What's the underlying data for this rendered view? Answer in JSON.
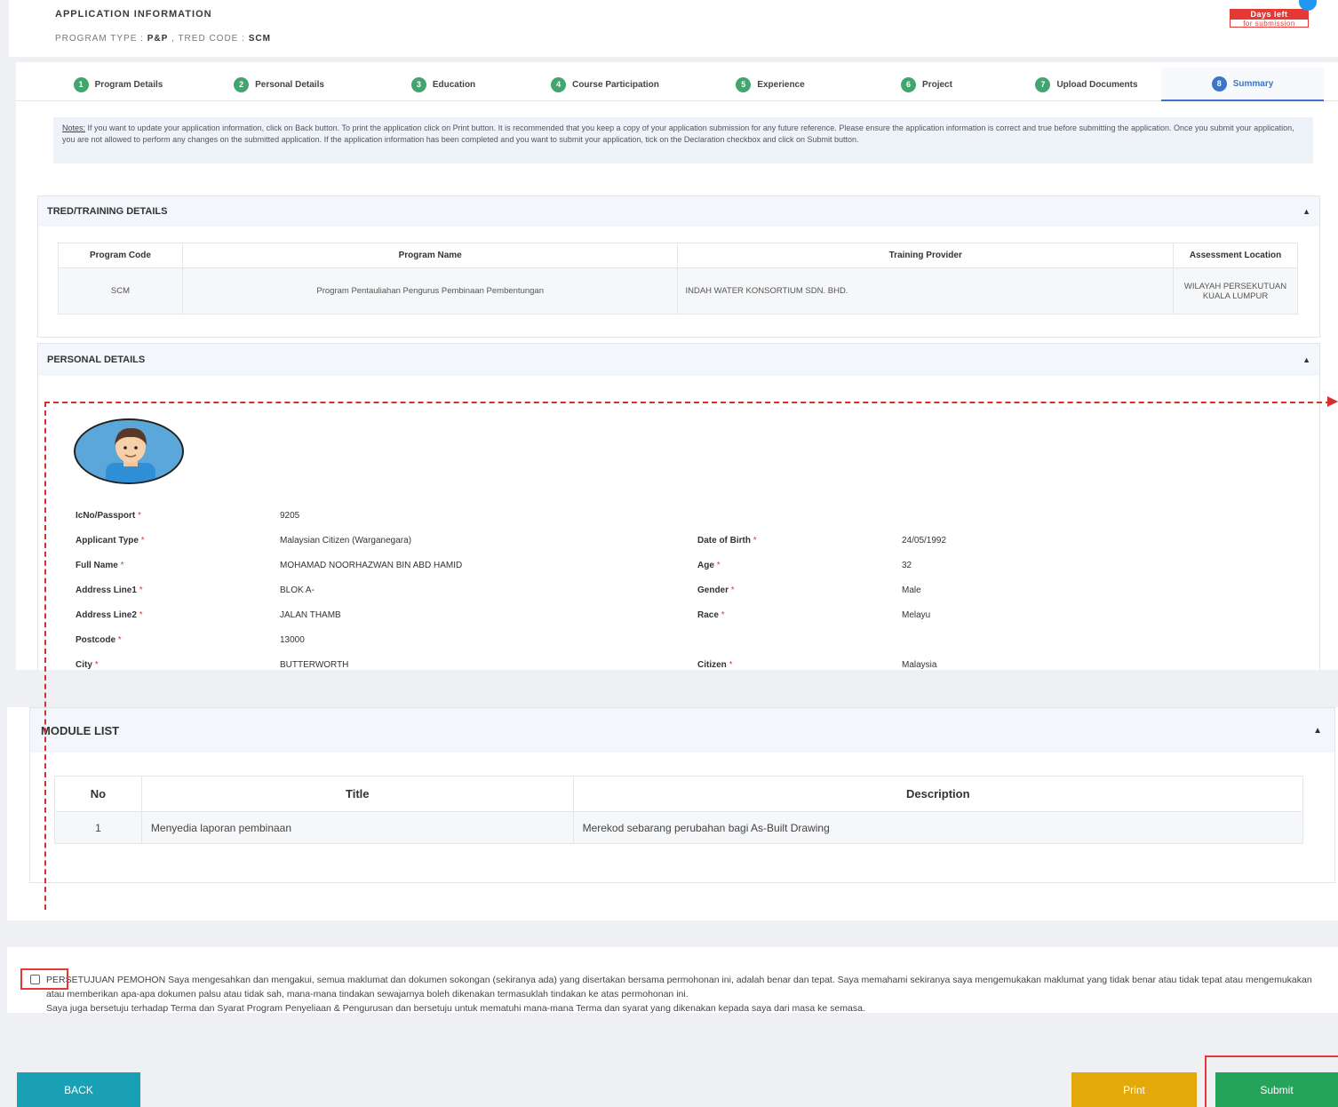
{
  "header": {
    "title": "APPLICATION INFORMATION",
    "program_type_label": "PROGRAM TYPE : ",
    "program_type_value": "P&P",
    "tred_code_label": " , TRED CODE : ",
    "tred_code_value": "SCM",
    "days_left_line1": "Days left",
    "days_left_line2": "for submission"
  },
  "tabs": [
    {
      "num": "1",
      "label": "Program Details"
    },
    {
      "num": "2",
      "label": "Personal Details"
    },
    {
      "num": "3",
      "label": "Education"
    },
    {
      "num": "4",
      "label": "Course Participation"
    },
    {
      "num": "5",
      "label": "Experience"
    },
    {
      "num": "6",
      "label": "Project"
    },
    {
      "num": "7",
      "label": "Upload Documents"
    },
    {
      "num": "8",
      "label": "Summary"
    }
  ],
  "notes": {
    "label": "Notes:",
    "text": " If you want to update your application information, click on Back button. To print the application click on Print button. It is recommended that you keep a copy of your application submission for any future reference. Please ensure the application information is correct and true before submitting the application. Once you submit your application, you are not allowed to perform any changes on the submitted application. If the application information has been completed and you want to submit your application, tick on the Declaration checkbox and click on Submit button."
  },
  "tred_section": {
    "title": "TRED/TRAINING DETAILS",
    "columns": [
      "Program Code",
      "Program Name",
      "Training Provider",
      "Assessment Location"
    ],
    "row": {
      "code": "SCM",
      "name": "Program Pentauliahan Pengurus Pembinaan Pembentungan",
      "provider": "INDAH WATER KONSORTIUM SDN. BHD.",
      "location": "WILAYAH PERSEKUTUAN KUALA LUMPUR"
    }
  },
  "personal_section": {
    "title": "PERSONAL DETAILS",
    "ic_label": "IcNo/Passport",
    "ic_value": "9205",
    "applicant_type_label": "Applicant Type",
    "applicant_type_value": "Malaysian Citizen (Warganegara)",
    "full_name_label": "Full Name",
    "full_name_value": "MOHAMAD NOORHAZWAN BIN ABD HAMID",
    "address1_label": "Address Line1",
    "address1_value": "BLOK A-",
    "address2_label": "Address Line2",
    "address2_value": "JALAN THAMB",
    "postcode_label": "Postcode",
    "postcode_value": "13000",
    "city_label": "City",
    "city_value": "BUTTERWORTH",
    "dob_label": "Date of Birth",
    "dob_value": "24/05/1992",
    "age_label": "Age",
    "age_value": "32",
    "gender_label": "Gender",
    "gender_value": "Male",
    "race_label": "Race",
    "race_value": "Melayu",
    "citizen_label": "Citizen",
    "citizen_value": "Malaysia",
    "required_mark": "*"
  },
  "module_section": {
    "title": "MODULE LIST",
    "columns": [
      "No",
      "Title",
      "Description"
    ],
    "row": {
      "no": "1",
      "title": "Menyedia laporan pembinaan",
      "description": "Merekod sebarang perubahan bagi As-Built Drawing"
    }
  },
  "declaration": {
    "line1": "PERSETUJUAN PEMOHON Saya mengesahkan dan mengakui, semua maklumat dan dokumen sokongan (sekiranya ada) yang disertakan bersama permohonan ini, adalah benar dan tepat. Saya memahami sekiranya saya mengemukakan maklumat yang tidak benar atau tidak tepat atau mengemukakan atau memberikan apa-apa dokumen palsu atau tidak sah, mana-mana tindakan sewajarnya boleh dikenakan termasuklah tindakan ke atas permohonan ini.",
    "line2": "Saya juga bersetuju terhadap Terma dan Syarat Program Penyeliaan & Pengurusan dan bersetuju untuk mematuhi mana-mana Terma dan syarat yang dikenakan kepada saya dari masa ke semasa."
  },
  "buttons": {
    "back": "BACK",
    "print": "Print",
    "submit": "Submit"
  },
  "colors": {
    "accent": "#3b74c9",
    "step": "#43a56e",
    "back": "#1aa0b4",
    "print": "#e3a90b",
    "submit": "#26a35a",
    "annotation": "#d32f2f"
  }
}
